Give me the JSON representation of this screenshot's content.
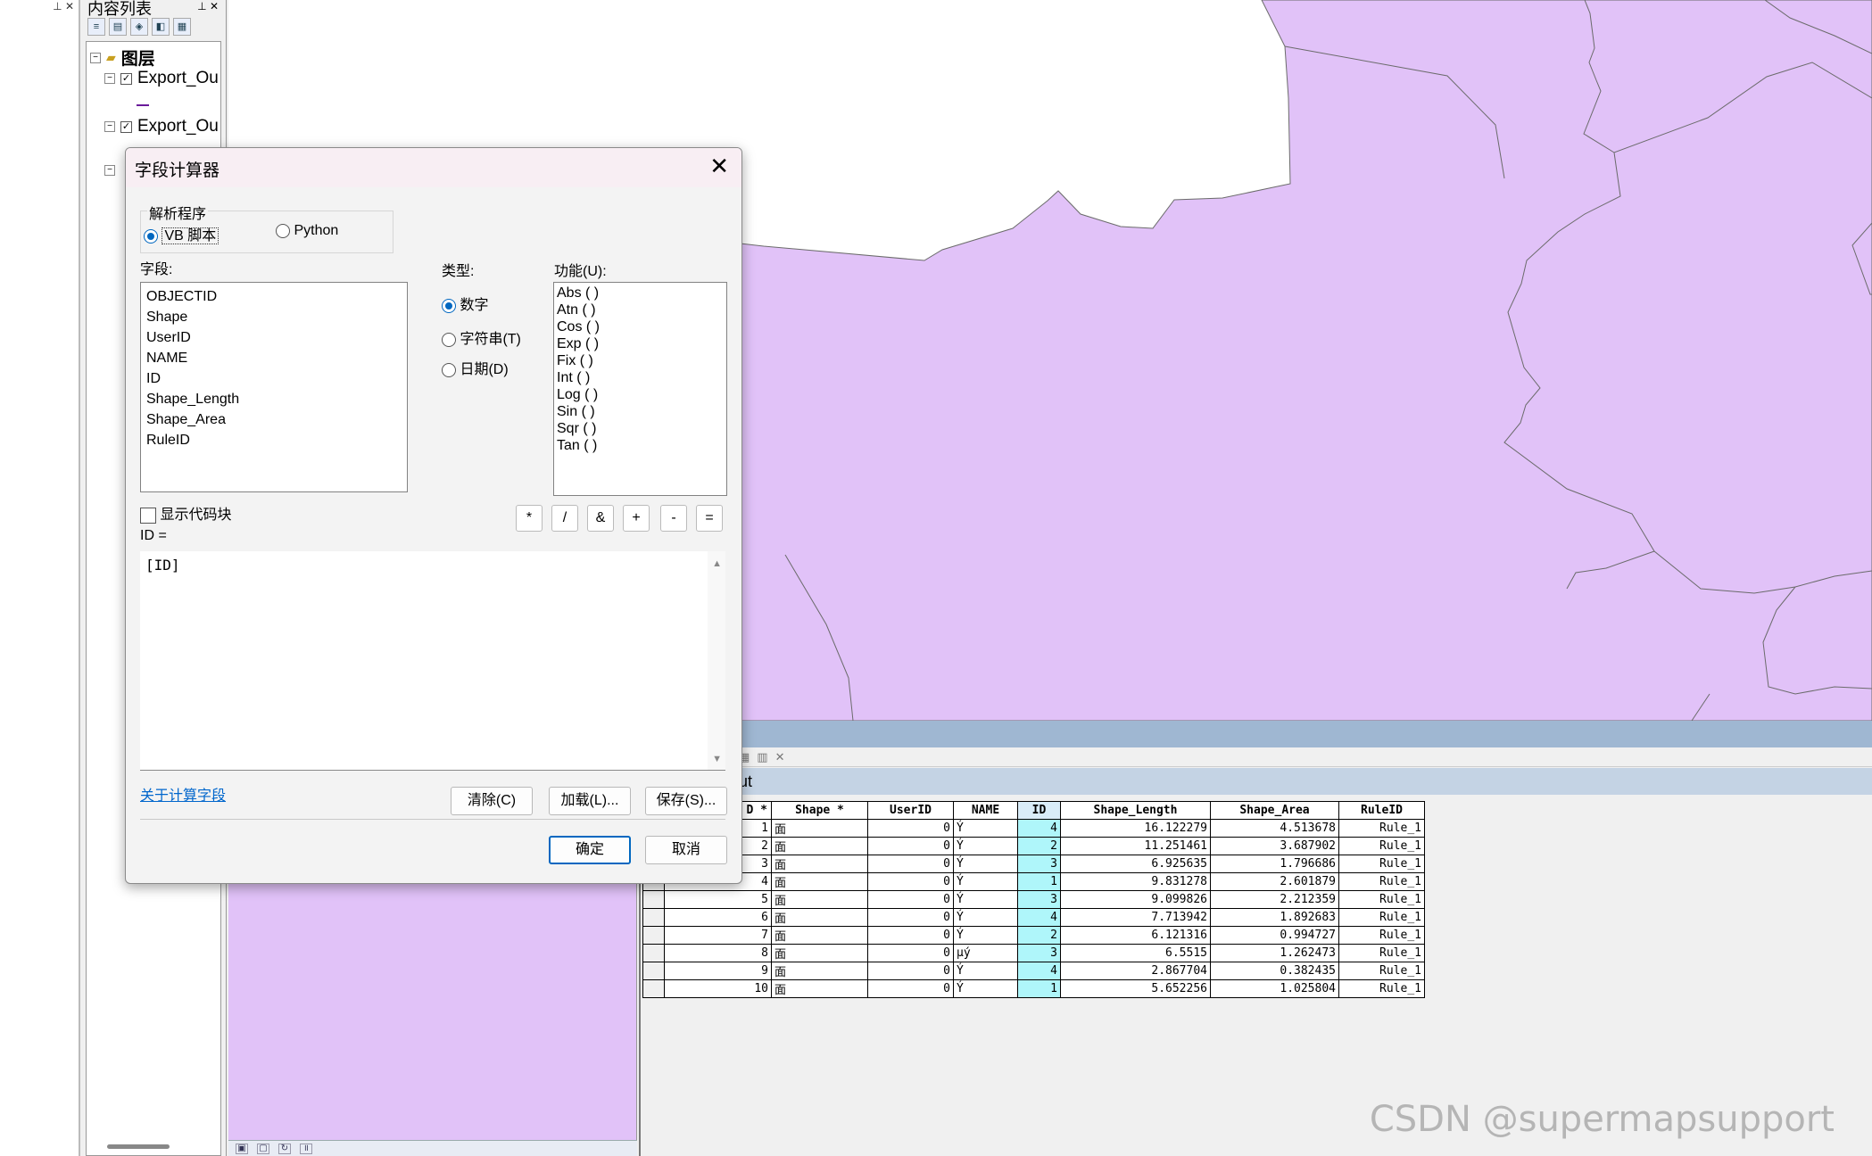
{
  "toc": {
    "title": "内容列表",
    "root_label": "图层",
    "layers": [
      "Export_Ou",
      "Export_Ou"
    ]
  },
  "dialog": {
    "title": "字段计算器",
    "parser_label": "解析程序",
    "parser_options": [
      "VB 脚本",
      "Python"
    ],
    "fields_label": "字段:",
    "fields": [
      "OBJECTID",
      "Shape",
      "UserID",
      "NAME",
      "ID",
      "Shape_Length",
      "Shape_Area",
      "RuleID"
    ],
    "type_label": "类型:",
    "types": [
      "数字",
      "字符串(T)",
      "日期(D)"
    ],
    "functions_label": "功能(U):",
    "functions": [
      "Abs ( )",
      "Atn ( )",
      "Cos ( )",
      "Exp ( )",
      "Fix ( )",
      "Int ( )",
      "Log ( )",
      "Sin ( )",
      "Sqr ( )",
      "Tan ( )"
    ],
    "show_codeblock": "显示代码块",
    "operators": [
      "*",
      "/",
      "&",
      "+",
      "-",
      "="
    ],
    "expression_label": "ID =",
    "expression": "[ID]",
    "about_link": "关于计算字段",
    "clear_button": "清除(C)",
    "load_button": "加载(L)...",
    "save_button": "保存(S)...",
    "ok_button": "确定",
    "cancel_button": "取消"
  },
  "table": {
    "name_fragment": "ut",
    "columns": [
      "D *",
      "Shape *",
      "UserID",
      "NAME",
      "ID",
      "Shape_Length",
      "Shape_Area",
      "RuleID"
    ],
    "rows": [
      [
        "1",
        "面",
        "0",
        "Ý",
        "4",
        "16.122279",
        "4.513678",
        "Rule_1"
      ],
      [
        "2",
        "面",
        "0",
        "Ý",
        "2",
        "11.251461",
        "3.687902",
        "Rule_1"
      ],
      [
        "3",
        "面",
        "0",
        "Ý",
        "3",
        "6.925635",
        "1.796686",
        "Rule_1"
      ],
      [
        "4",
        "面",
        "0",
        "Ý",
        "1",
        "9.831278",
        "2.601879",
        "Rule_1"
      ],
      [
        "5",
        "面",
        "0",
        "Ý",
        "3",
        "9.099826",
        "2.212359",
        "Rule_1"
      ],
      [
        "6",
        "面",
        "0",
        "Ý",
        "4",
        "7.713942",
        "1.892683",
        "Rule_1"
      ],
      [
        "7",
        "面",
        "0",
        "Ý",
        "2",
        "6.121316",
        "0.994727",
        "Rule_1"
      ],
      [
        "8",
        "面",
        "0",
        "μý",
        "3",
        "6.5515",
        "1.262473",
        "Rule_1"
      ],
      [
        "9",
        "面",
        "0",
        "Ý",
        "4",
        "2.867704",
        "0.382435",
        "Rule_1"
      ],
      [
        "10",
        "面",
        "0",
        "Ý",
        "1",
        "5.652256",
        "1.025804",
        "Rule_1"
      ]
    ]
  },
  "watermark": "CSDN @supermapsupport",
  "colors": {
    "polygon_fill": "#e1c2f8",
    "accent": "#0067c0",
    "id_column": "#aff6fa"
  }
}
